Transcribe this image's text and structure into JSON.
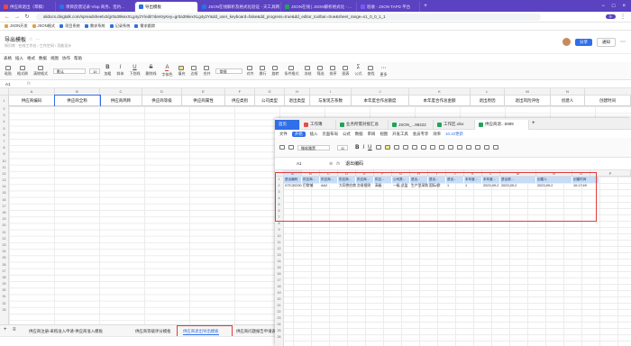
{
  "browser": {
    "tabs": [
      {
        "label": "供应商退出（草稿）"
      },
      {
        "label": "项目反馈记录-Vlop 商务、签约..."
      },
      {
        "label": "导出模板"
      },
      {
        "label": "JSON在线解析及格式化验证 - 天工具网"
      },
      {
        "label": "JSON在线 | JSON解析格式化 - ..."
      },
      {
        "label": "验收 - JSON TAPD 平台"
      }
    ],
    "url": "alidocs.dingtalk.com/spreadsheetv2/gr0a39kexXLg4y2Y/edit?dentryKey=gr0a39kexXLg4y2Y&dd_user_keyboard=false&dd_progress=true&dd_editor_toolbar=true&sheet_range=s1_0_0_1_1",
    "bookmarks": [
      "JSON开发",
      "JSON格式",
      "项目系统",
      "需求系统",
      "记录系统",
      "需求跟踪"
    ]
  },
  "app": {
    "title": "导出模板",
    "subtitle": "知识库 · 在线工作台 / 工作空间 / 功能设计",
    "share_label": "分享",
    "notify_label": "通知"
  },
  "menus": [
    "表格",
    "插入",
    "格式",
    "数据",
    "视图",
    "协作",
    "帮助"
  ],
  "toolbar": {
    "font": "默认",
    "size": "10",
    "items": [
      "粘贴",
      "格式刷",
      "清除格式",
      "加粗",
      "斜体",
      "下划线",
      "删除线",
      "字体色",
      "填充",
      "边框",
      "合并",
      "对齐",
      "换行",
      "旋转",
      "条件格式",
      "冻结",
      "筛选",
      "排序",
      "图表",
      "公式",
      "查找",
      "更多"
    ],
    "style_label": "常规"
  },
  "cell_ref": "A1",
  "main_sheet": {
    "columns": [
      "A",
      "B",
      "C",
      "D",
      "E",
      "F",
      "G",
      "H",
      "I",
      "J",
      "K",
      "L",
      "M",
      "N"
    ],
    "headers": [
      "供应商编码",
      "供应商全称",
      "供应商简称",
      "供应商等级",
      "供应商属性",
      "供应类别",
      "公司类型",
      "退出类型",
      "与发现方系数",
      "本年度合作总额度",
      "本年度合作总金额",
      "退出原因",
      "退出风险评估",
      "创建人",
      "创建时间"
    ],
    "row_numbers": [
      "2",
      "3",
      "4",
      "5",
      "6",
      "7",
      "8",
      "9",
      "10",
      "11",
      "12",
      "13",
      "14",
      "15",
      "16",
      "17",
      "18",
      "19",
      "20",
      "21",
      "22",
      "23",
      "24",
      "25",
      "26",
      "27",
      "28",
      "29",
      "30",
      "31",
      "32",
      "33"
    ],
    "sheet_tabs": [
      "供应商注册-采购准入申请-供应商准入模板",
      "供应商等级评分模板",
      "供应商退出导出模板",
      "供应商问题报告申请表..."
    ],
    "active_sheet": "供应商退出导出模板"
  },
  "excel": {
    "tabs": [
      "首页",
      "工作簿",
      "业务所需对接汇总",
      "JSON_...99222",
      "工作区.xlsx",
      "供应商退...5989"
    ],
    "menus": [
      "文件",
      "开始",
      "插入",
      "页面布局",
      "公式",
      "数据",
      "审阅",
      "视图",
      "开发工具",
      "会员专享",
      "效率",
      "10.22更新"
    ],
    "font": "微软雅黑",
    "size": "11",
    "cell_ref": "A1",
    "formula": "退出编码",
    "columns": [
      "A",
      "B",
      "C",
      "D",
      "E",
      "F",
      "G",
      "H",
      "I",
      "J",
      "K",
      "L",
      "M",
      "N",
      "O",
      "P"
    ],
    "header_row": [
      "退出编码",
      "供应商...",
      "供应商...",
      "供应商...",
      "供应商...",
      "供应...",
      "公司类...",
      "退出...",
      "退出...",
      "退出...",
      "本年度...",
      "本年度...",
      "退出原...",
      "创建人",
      "创建时间"
    ],
    "data_row": [
      "GTC20230",
      "巴黎城",
      "AA2",
      "大同供应商",
      "交易规则",
      "高级",
      "一级-总监",
      "生产型采购",
      "国际/欧",
      "1",
      "1",
      "2023-09-2",
      "2023-09-2",
      "2023-09-2",
      "10:17:49"
    ],
    "row_numbers": [
      "1",
      "2",
      "3",
      "4",
      "5",
      "6",
      "7",
      "8",
      "9",
      "10",
      "11",
      "12",
      "13",
      "14",
      "15",
      "16",
      "17",
      "18",
      "19",
      "20",
      "21",
      "22",
      "23",
      "24",
      "25",
      "26"
    ],
    "logo": "WPS"
  }
}
